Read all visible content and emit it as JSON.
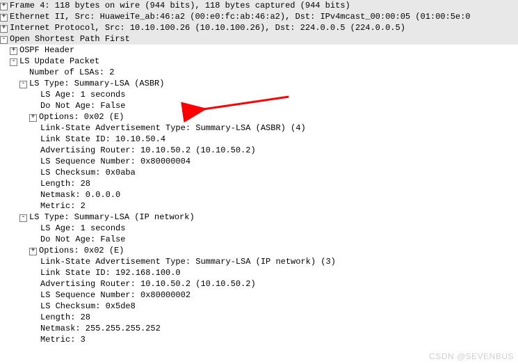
{
  "headers": {
    "frame": "Frame 4: 118 bytes on wire (944 bits), 118 bytes captured (944 bits)",
    "eth": "Ethernet II, Src: HuaweiTe_ab:46:a2 (00:e0:fc:ab:46:a2), Dst: IPv4mcast_00:00:05 (01:00:5e:0",
    "ip": "Internet Protocol, Src: 10.10.100.26 (10.10.100.26), Dst: 224.0.0.5 (224.0.0.5)",
    "ospf": "Open Shortest Path First"
  },
  "ospf_header": "OSPF Header",
  "lsu": {
    "label": "LS Update Packet",
    "num_lsas": "Number of LSAs: 2",
    "items": [
      {
        "type_label": "LS Type: Summary-LSA (ASBR)",
        "age": "LS Age: 1 seconds",
        "dna": "Do Not Age: False",
        "options": "Options: 0x02 (E)",
        "lsa_type": "Link-State Advertisement Type: Summary-LSA (ASBR) (4)",
        "ls_id": "Link State ID: 10.10.50.4",
        "adv": "Advertising Router: 10.10.50.2 (10.10.50.2)",
        "seq": "LS Sequence Number: 0x80000004",
        "cksum": "LS Checksum: 0x0aba",
        "length": "Length: 28",
        "netmask": "Netmask: 0.0.0.0",
        "metric": "Metric: 2"
      },
      {
        "type_label": "LS Type: Summary-LSA (IP network)",
        "age": "LS Age: 1 seconds",
        "dna": "Do Not Age: False",
        "options": "Options: 0x02 (E)",
        "lsa_type": "Link-State Advertisement Type: Summary-LSA (IP network) (3)",
        "ls_id": "Link State ID: 192.168.100.0",
        "adv": "Advertising Router: 10.10.50.2 (10.10.50.2)",
        "seq": "LS Sequence Number: 0x80000002",
        "cksum": "LS Checksum: 0x5de8",
        "length": "Length: 28",
        "netmask": "Netmask: 255.255.255.252",
        "metric": "Metric: 3"
      }
    ]
  },
  "watermark": "CSDN @SEVENBUS"
}
